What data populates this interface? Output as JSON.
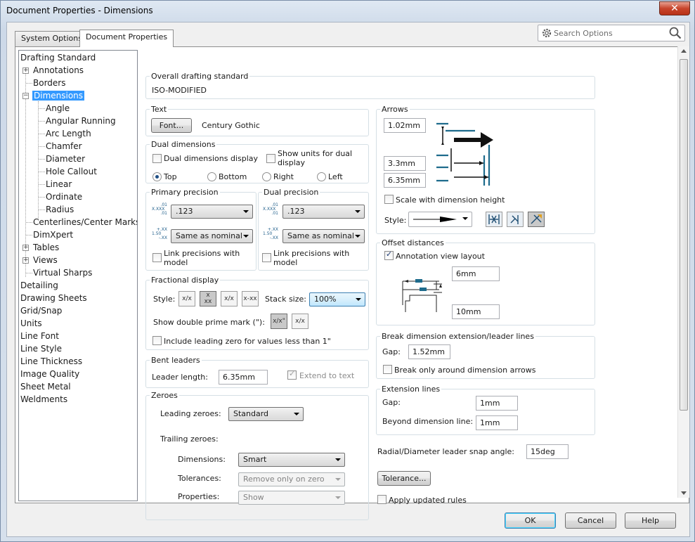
{
  "window": {
    "title": "Document Properties - Dimensions",
    "close_glyph": "✕"
  },
  "tabs": {
    "system": "System Options",
    "document": "Document Properties"
  },
  "search": {
    "placeholder": "Search Options"
  },
  "tree": {
    "items": [
      {
        "label": "Drafting Standard"
      },
      {
        "label": "Annotations",
        "expander": "+"
      },
      {
        "label": "Borders"
      },
      {
        "label": "Dimensions",
        "expander": "−"
      },
      {
        "label": "Angle"
      },
      {
        "label": "Angular Running"
      },
      {
        "label": "Arc Length"
      },
      {
        "label": "Chamfer"
      },
      {
        "label": "Diameter"
      },
      {
        "label": "Hole Callout"
      },
      {
        "label": "Linear"
      },
      {
        "label": "Ordinate"
      },
      {
        "label": "Radius"
      },
      {
        "label": "Centerlines/Center Marks"
      },
      {
        "label": "DimXpert"
      },
      {
        "label": "Tables",
        "expander": "+"
      },
      {
        "label": "Views",
        "expander": "+"
      },
      {
        "label": "Virtual Sharps"
      },
      {
        "label": "Detailing"
      },
      {
        "label": "Drawing Sheets"
      },
      {
        "label": "Grid/Snap"
      },
      {
        "label": "Units"
      },
      {
        "label": "Line Font"
      },
      {
        "label": "Line Style"
      },
      {
        "label": "Line Thickness"
      },
      {
        "label": "Image Quality"
      },
      {
        "label": "Sheet Metal"
      },
      {
        "label": "Weldments"
      }
    ]
  },
  "overall": {
    "title": "Overall drafting standard",
    "value": "ISO-MODIFIED"
  },
  "text_group": {
    "title": "Text",
    "font_button": "Font...",
    "font_name": "Century Gothic"
  },
  "dual": {
    "title": "Dual dimensions",
    "display_label": "Dual dimensions display",
    "show_units_label": "Show units for dual display",
    "top": "Top",
    "bottom": "Bottom",
    "right": "Right",
    "left": "Left"
  },
  "primary_precision": {
    "title": "Primary precision",
    "value": ".123",
    "tolerance": "Same as nominal",
    "link_label": "Link precisions with model",
    "icon_value": ".01",
    "icon_value_mid": "X.XXX",
    "icon_tol": "+.XX",
    "icon_tol_mid": "1.50",
    "icon_tol_low": "-.XX"
  },
  "dual_precision": {
    "title": "Dual precision",
    "value": ".123",
    "tolerance": "Same as nominal",
    "link_label": "Link precisions with model",
    "icon_value": ".01",
    "icon_value_mid": "X.XXX",
    "icon_tol": "+.XX",
    "icon_tol_mid": "1.50",
    "icon_tol_low": "-.XX"
  },
  "fractional": {
    "title": "Fractional display",
    "style_label": "Style:",
    "style_icons": [
      "x/x",
      "x\nxx",
      "x/x",
      "x-xx"
    ],
    "stack_label": "Stack size:",
    "stack_value": "100%",
    "prime_label": "Show double prime mark (\"):",
    "prime_icons": [
      "x/x\"",
      "x/x"
    ],
    "leading_zero_label": "Include leading zero for values less than 1\""
  },
  "bent": {
    "title": "Bent leaders",
    "length_label": "Leader length:",
    "length_value": "6.35mm",
    "extend_label": "Extend to text"
  },
  "zeroes": {
    "title": "Zeroes",
    "leading_label": "Leading zeroes:",
    "leading_value": "Standard",
    "trailing_label": "Trailing zeroes:",
    "dimensions_label": "Dimensions:",
    "dimensions_value": "Smart",
    "tolerances_label": "Tolerances:",
    "tolerances_value": "Remove only on zero",
    "properties_label": "Properties:",
    "properties_value": "Show"
  },
  "arrows": {
    "title": "Arrows",
    "size1": "1.02mm",
    "size2": "3.3mm",
    "size3": "6.35mm",
    "scale_label": "Scale with dimension height",
    "style_label": "Style:"
  },
  "offset": {
    "title": "Offset distances",
    "layout_label": "Annotation view layout",
    "d1": "6mm",
    "d2": "10mm"
  },
  "break": {
    "title": "Break dimension extension/leader lines",
    "gap_label": "Gap:",
    "gap_value": "1.52mm",
    "only_label": "Break only around dimension arrows"
  },
  "extension": {
    "title": "Extension lines",
    "gap_label": "Gap:",
    "gap_value": "1mm",
    "beyond_label": "Beyond dimension line:",
    "beyond_value": "1mm"
  },
  "snap": {
    "label": "Radial/Diameter leader snap angle:",
    "value": "15deg"
  },
  "tolerance_button": "Tolerance...",
  "apply_label": "Apply updated rules",
  "footer": {
    "ok": "OK",
    "cancel": "Cancel",
    "help": "Help"
  },
  "colors": {
    "accent": "#3399ff",
    "diagram": "#1e6b8c"
  }
}
